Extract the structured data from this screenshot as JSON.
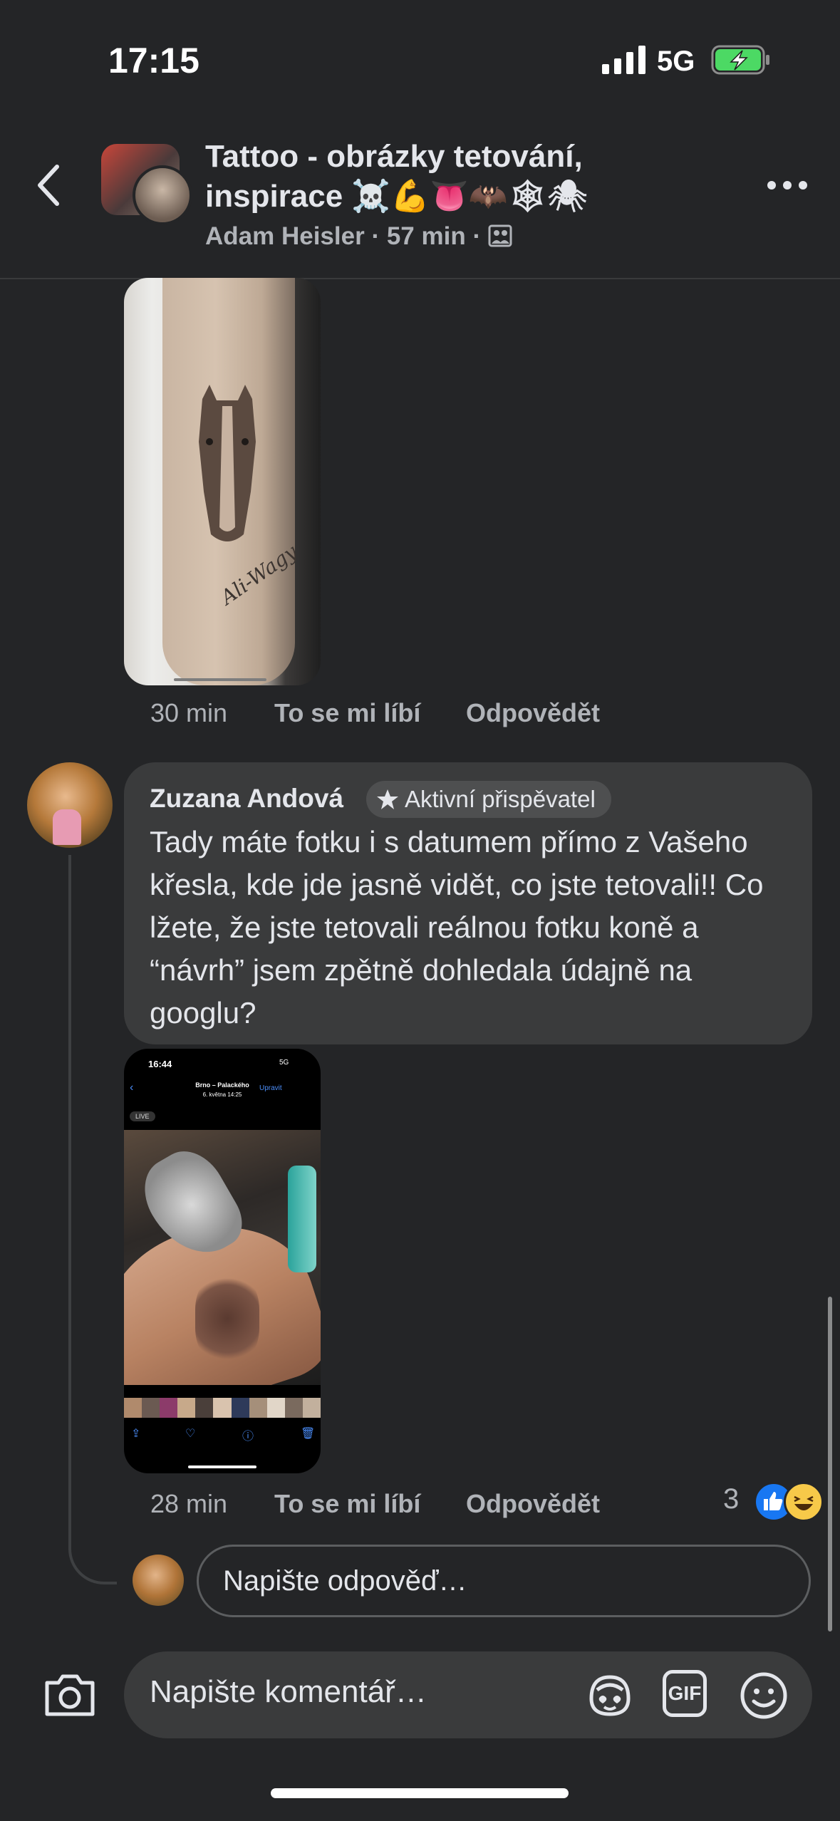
{
  "status_bar": {
    "time": "17:15",
    "network": "5G"
  },
  "header": {
    "group_title": "Tattoo - obrázky tetování, inspirace ☠️💪👅🦇🕸🕷",
    "author": "Adam Heisler",
    "age": "57 min"
  },
  "first_comment": {
    "time": "30 min",
    "like_label": "To se mi líbí",
    "reply_label": "Odpovědět",
    "image_signature": "Ali-Wagy"
  },
  "comment": {
    "author": "Zuzana Andová",
    "badge": "Aktivní přispěvatel",
    "text": "Tady máte fotku i s datumem přímo z Vašeho křesla, kde jde jasně vidět, co jste tetovali!! Co lžete, že jste tetovali reálnou fotku koně a “návrh” jsem zpětně dohledala údajně na googlu?",
    "time": "28 min",
    "like_label": "To se mi líbí",
    "reply_label": "Odpovědět",
    "reaction_count": "3",
    "reactions": [
      "like",
      "haha"
    ]
  },
  "screenshot_image": {
    "time": "16:44",
    "network": "5G",
    "location": "Brno – Palackého",
    "date": "6. května 14:25",
    "edit_label": "Upravit",
    "live_label": "LIVE"
  },
  "reply_input": {
    "placeholder": "Napište odpověď…"
  },
  "composer": {
    "placeholder": "Napište komentář…",
    "gif_label": "GIF"
  },
  "colors": {
    "background": "#242527",
    "bubble": "#3a3b3c",
    "text": "#e4e6eb",
    "secondary": "#b0b3b8",
    "accent": "#1877f2"
  }
}
